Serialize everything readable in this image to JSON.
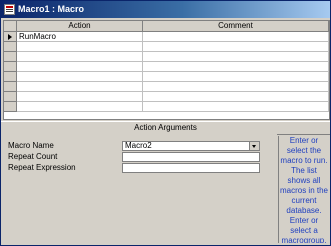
{
  "window": {
    "title": "Macro1 : Macro"
  },
  "grid": {
    "columns": [
      "Action",
      "Comment"
    ],
    "rows": [
      {
        "action": "RunMacro",
        "comment": ""
      },
      {
        "action": "",
        "comment": ""
      },
      {
        "action": "",
        "comment": ""
      },
      {
        "action": "",
        "comment": ""
      },
      {
        "action": "",
        "comment": ""
      },
      {
        "action": "",
        "comment": ""
      },
      {
        "action": "",
        "comment": ""
      },
      {
        "action": "",
        "comment": ""
      }
    ]
  },
  "arguments": {
    "header": "Action Arguments",
    "fields": [
      {
        "label": "Macro Name",
        "value": "Macro2",
        "type": "dropdown"
      },
      {
        "label": "Repeat Count",
        "value": "",
        "type": "text"
      },
      {
        "label": "Repeat Expression",
        "value": "",
        "type": "text"
      }
    ],
    "help_text": "Enter or select the macro to run. The list shows all macros in the current database. Enter or select a macrogroup."
  }
}
